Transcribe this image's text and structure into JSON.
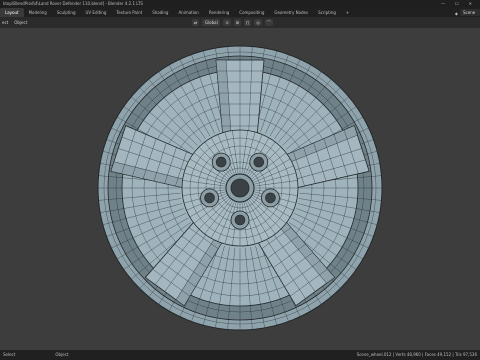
{
  "app": {
    "window_title": "ktop\\BlendProd\\4\\Land Rover Defender 110.blend] - Blender 4.2.1 LTS",
    "window_buttons": [
      "—",
      "☐",
      "✕"
    ]
  },
  "menubar": {
    "tabs": [
      "Layout",
      "Modeling",
      "Sculpting",
      "UV Editing",
      "Texture Paint",
      "Shading",
      "Animation",
      "Rendering",
      "Compositing",
      "Geometry Nodes",
      "Scripting",
      "+"
    ],
    "active_tab": "Layout",
    "scene_label": "Scene"
  },
  "viewport_header": {
    "left_items": [
      "ect",
      "Object"
    ],
    "transform_orientation": "Global"
  },
  "statusbar": {
    "left_items": [
      "Select",
      "Object"
    ],
    "right_text": "Scene_wheel.012 | Verts 48,960 | Faces 49,152 | Tris 97,536"
  },
  "colors": {
    "wheel_body": "#9fb3bc",
    "wheel_dark": "#6f8189",
    "wireframe": "#2a2f33",
    "viewport_bg": "#3d3d3d"
  },
  "icons": [
    "shield-icon",
    "cursor-icon",
    "global-orientation-icon",
    "pivot-icon",
    "snap-icon",
    "magnet-icon",
    "proportional-icon",
    "scene-icon"
  ]
}
